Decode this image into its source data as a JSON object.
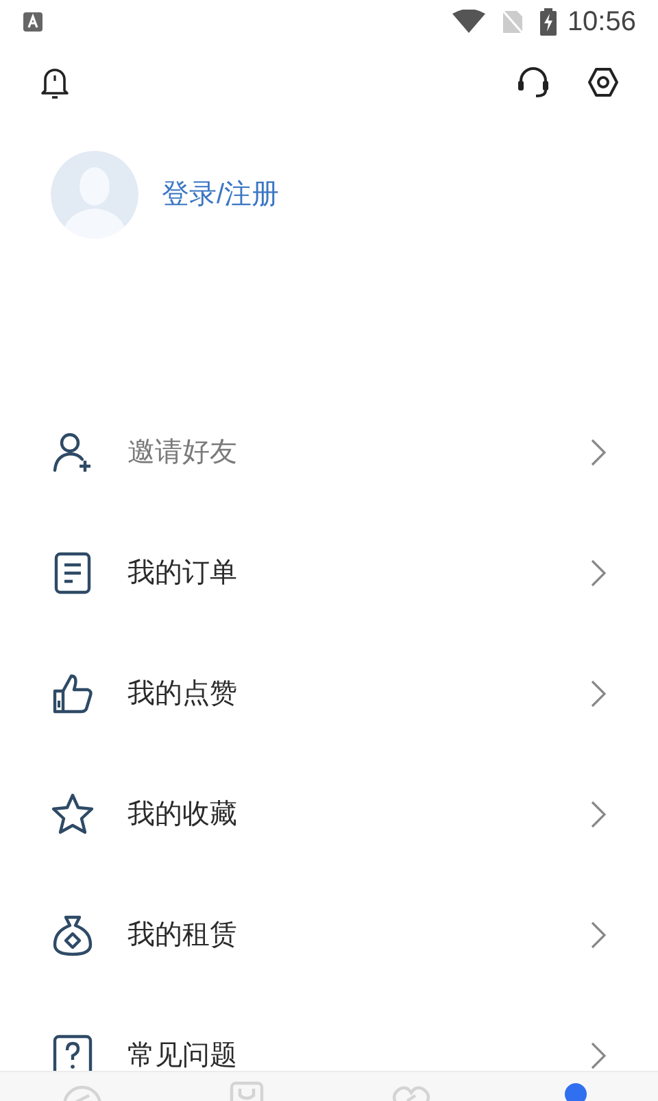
{
  "status_bar": {
    "time": "10:56"
  },
  "profile": {
    "login_label": "登录/注册"
  },
  "menu": [
    {
      "kind": "invite",
      "label": "邀请好友",
      "dimmed": true
    },
    {
      "kind": "orders",
      "label": "我的订单",
      "dimmed": false
    },
    {
      "kind": "likes",
      "label": "我的点赞",
      "dimmed": false
    },
    {
      "kind": "favorites",
      "label": "我的收藏",
      "dimmed": false
    },
    {
      "kind": "rentals",
      "label": "我的租赁",
      "dimmed": false
    },
    {
      "kind": "faq",
      "label": "常见问题",
      "dimmed": false
    }
  ],
  "bottom_nav": [
    {
      "kind": "compass",
      "selected": false
    },
    {
      "kind": "bag",
      "selected": false
    },
    {
      "kind": "heart",
      "selected": false
    },
    {
      "kind": "profile",
      "selected": true
    }
  ]
}
